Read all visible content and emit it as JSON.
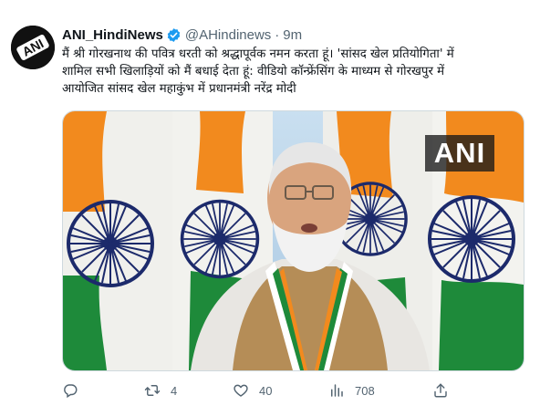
{
  "tweet": {
    "display_name": "ANI_HindiNews",
    "handle": "@AHindinews",
    "separator": "·",
    "time": "9m",
    "avatar_text": "ANI",
    "text_lines": [
      "मैं श्री गोरखनाथ की पवित्र धरती को श्रद्धापूर्वक नमन करता हूं। 'सांसद खेल प्रतियोगिता' में",
      "शामिल सभी खिलाड़ियों को मैं बधाई देता हूं: वीडियो कॉन्फ्रेंसिंग के माध्यम से गोरखपुर में",
      "आयोजित सांसद खेल महाकुंभ में प्रधानमंत्री नरेंद्र मोदी"
    ],
    "media_watermark": "ANI"
  },
  "actions": {
    "reply_icon": "reply-icon",
    "retweet_icon": "retweet-icon",
    "retweet_count": "4",
    "like_icon": "heart-icon",
    "like_count": "40",
    "views_icon": "analytics-icon",
    "views_count": "708",
    "share_icon": "share-icon"
  },
  "colors": {
    "verified": "#1d9bf0",
    "secondary_text": "#536471",
    "saffron": "#f28a1e",
    "green": "#1e8a3a",
    "chakra": "#1c2a6b"
  }
}
